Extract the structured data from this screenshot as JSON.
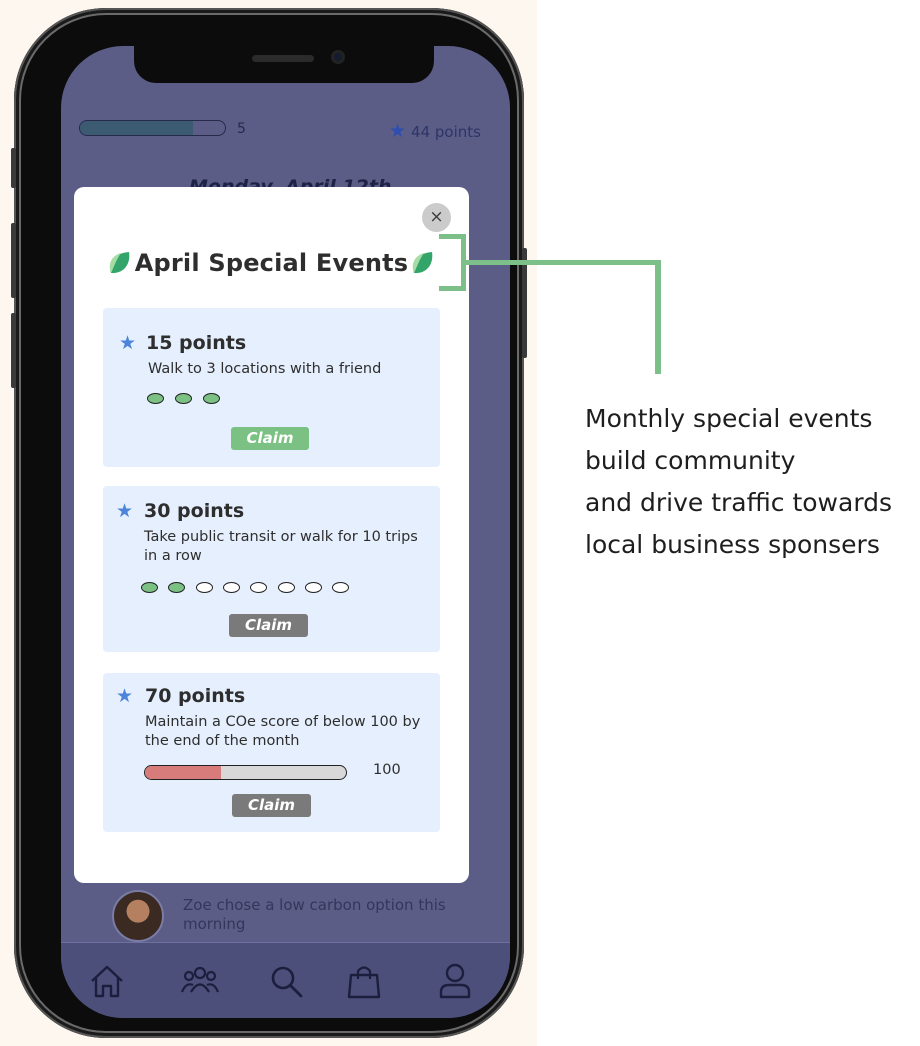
{
  "header": {
    "level_progress": 0.78,
    "level_number": "5",
    "points_label": "44 points",
    "date": "Monday, April 12th"
  },
  "modal": {
    "title": "April Special Events",
    "close_label": "×",
    "events": [
      {
        "points": "15 points",
        "description": "Walk to 3 locations with a friend",
        "progress_dots": [
          true,
          true,
          true
        ],
        "claim_label": "Claim",
        "claim_enabled": true
      },
      {
        "points": "30 points",
        "description": "Take public transit or walk for 10 trips in a row",
        "progress_dots": [
          true,
          true,
          false,
          false,
          false,
          false,
          false,
          false
        ],
        "claim_label": "Claim",
        "claim_enabled": false
      },
      {
        "points": "70 points",
        "description": "Maintain a COe score of below 100 by the end of the month",
        "score_progress": 0.38,
        "score_limit": "100",
        "claim_label": "Claim",
        "claim_enabled": false
      }
    ]
  },
  "feed": {
    "item_text": "Zoe chose a low carbon option this morning"
  },
  "nav": {
    "items": [
      "home-icon",
      "friends-icon",
      "search-icon",
      "shop-bag-icon",
      "profile-icon"
    ]
  },
  "annotation": {
    "lines": [
      "Monthly special events",
      "build community",
      "and drive traffic towards",
      "local business sponsers"
    ]
  },
  "colors": {
    "screen_bg": "#5b5d86",
    "card_bg": "#e6effd",
    "claim_active": "#7cc184",
    "claim_inactive": "#7a7a7a",
    "annotation_line": "#7cbf88",
    "star_blue": "#4b84d8"
  }
}
